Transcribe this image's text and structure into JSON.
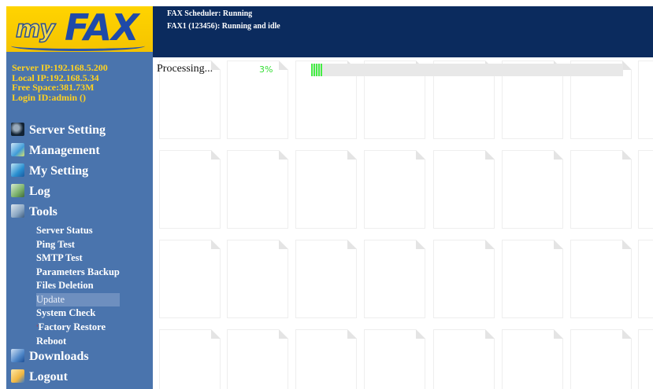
{
  "header": {
    "status_lines": [
      "FAX Scheduler: Running",
      "FAX1 (123456): Running and idle"
    ]
  },
  "logo": {
    "my": "my",
    "fax": "FAX"
  },
  "server_info": [
    "Server IP:192.168.5.200",
    "Local IP:192.168.5.34",
    "Free Space:381.73M",
    "Login ID:admin ()"
  ],
  "menu": {
    "server_setting": "Server Setting",
    "management": "Management",
    "my_setting": "My Setting",
    "log": "Log",
    "tools": "Tools",
    "downloads": "Downloads",
    "logout": "Logout"
  },
  "tools_submenu": [
    "Server Status",
    "Ping Test",
    "SMTP Test",
    "Parameters Backup",
    "Files Deletion",
    "Update",
    "System Check",
    "Factory Restore",
    "Reboot"
  ],
  "selected_tool": "Update",
  "icons": {
    "server_setting": "server-icon",
    "management": "management-icon",
    "my_setting": "my-setting-icon",
    "log": "log-icon",
    "tools": "tools-icon",
    "downloads": "downloads-icon",
    "logout": "logout-icon"
  },
  "processing": {
    "label": "Processing...",
    "percent_text": "3%",
    "progress": 0.03
  },
  "colors": {
    "sidebar_bg": "#4a74ad",
    "header_bg": "#0b2b5e",
    "server_info_text": "#ffd21f",
    "logo_bg": "#ffd400",
    "progress_green": "#44ee44"
  }
}
